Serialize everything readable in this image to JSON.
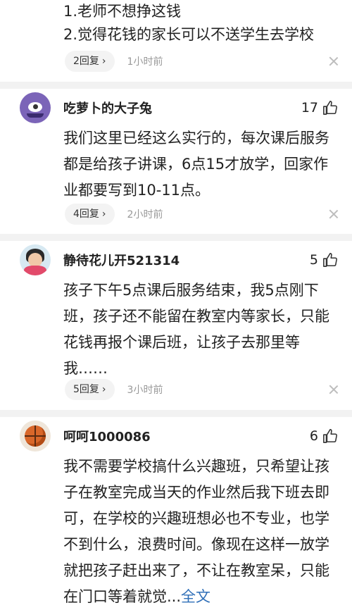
{
  "top_fragment": {
    "lines": [
      "1.老师不想挣这钱",
      "2.觉得花钱的家长可以不送学生去学校"
    ],
    "replies": "2回复",
    "time": "1小时前"
  },
  "comments": [
    {
      "username": "吃萝卜的大子兔",
      "likes": "17",
      "text": "我们这里已经这么实行的，每次课后服务都是给孩子讲课，6点15才放学，回家作业都要写到10-11点。",
      "replies": "4回复",
      "time": "2小时前"
    },
    {
      "username": "静待花儿开521314",
      "likes": "5",
      "text": "孩子下午5点课后服务结束，我5点刚下班，孩子还不能留在教室内等家长，只能花钱再报个课后班，让孩子去那里等我……",
      "replies": "5回复",
      "time": "3小时前"
    },
    {
      "username": "呵呵1000086",
      "likes": "6",
      "text": "我不需要学校搞什么兴趣班，只希望让孩子在教室完成当天的作业然后我下班去即可，在学校的兴趣班想必也不专业，也学不到什么，浪费时间。像现在这样一放学就把孩子赶出来了，不让在教室呆，只能在门口等着就觉...",
      "full_text_link": "全文"
    }
  ],
  "icons": {
    "reply_chevron": "chevron-right-icon",
    "like": "thumb-up-icon",
    "dismiss": "close-icon"
  },
  "colors": {
    "link": "#2f6fb8",
    "divider": "#f2f2f2",
    "muted": "#999999"
  }
}
